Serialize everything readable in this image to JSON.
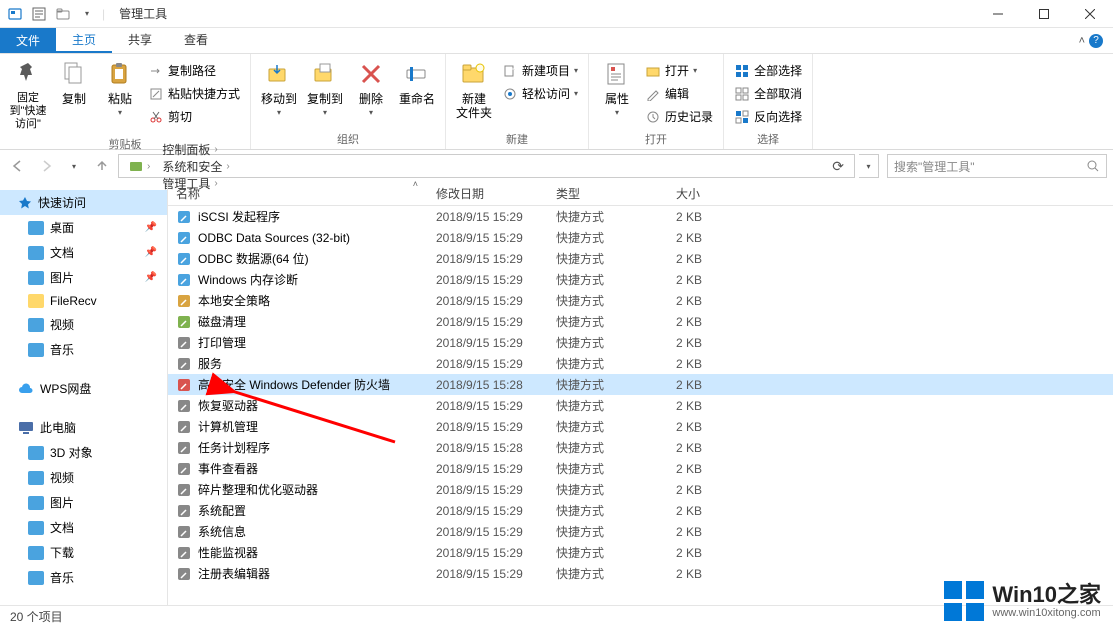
{
  "titlebar": {
    "title": "管理工具"
  },
  "tabs": {
    "file": "文件",
    "home": "主页",
    "share": "共享",
    "view": "查看"
  },
  "ribbon": {
    "pin": {
      "label": "固定到\"快速访问\""
    },
    "copy": "复制",
    "paste": "粘贴",
    "copy_path": "复制路径",
    "paste_shortcut": "粘贴快捷方式",
    "cut": "剪切",
    "group_clipboard": "剪贴板",
    "moveto": "移动到",
    "copyto": "复制到",
    "delete": "删除",
    "rename": "重命名",
    "group_organize": "组织",
    "new_folder": "新建\n文件夹",
    "new_item": "新建项目",
    "easy_access": "轻松访问",
    "group_new": "新建",
    "properties": "属性",
    "open": "打开",
    "edit": "编辑",
    "history": "历史记录",
    "group_open": "打开",
    "select_all": "全部选择",
    "select_none": "全部取消",
    "invert": "反向选择",
    "group_select": "选择"
  },
  "breadcrumbs": [
    "控制面板",
    "系统和安全",
    "管理工具"
  ],
  "search_placeholder": "搜索\"管理工具\"",
  "columns": {
    "name": "名称",
    "date": "修改日期",
    "type": "类型",
    "size": "大小"
  },
  "sidebar": {
    "quickaccess": "快速访问",
    "items1": [
      {
        "label": "桌面",
        "pin": true
      },
      {
        "label": "文档",
        "pin": true
      },
      {
        "label": "图片",
        "pin": true
      },
      {
        "label": "FileRecv",
        "pin": false
      },
      {
        "label": "视频",
        "pin": false
      },
      {
        "label": "音乐",
        "pin": false
      }
    ],
    "wps": "WPS网盘",
    "thispc": "此电脑",
    "items2": [
      {
        "label": "3D 对象"
      },
      {
        "label": "视频"
      },
      {
        "label": "图片"
      },
      {
        "label": "文档"
      },
      {
        "label": "下载"
      },
      {
        "label": "音乐"
      }
    ]
  },
  "files": [
    {
      "name": "iSCSI 发起程序",
      "date": "2018/9/15 15:29",
      "type": "快捷方式",
      "size": "2 KB",
      "sel": false
    },
    {
      "name": "ODBC Data Sources (32-bit)",
      "date": "2018/9/15 15:29",
      "type": "快捷方式",
      "size": "2 KB",
      "sel": false
    },
    {
      "name": "ODBC 数据源(64 位)",
      "date": "2018/9/15 15:29",
      "type": "快捷方式",
      "size": "2 KB",
      "sel": false
    },
    {
      "name": "Windows 内存诊断",
      "date": "2018/9/15 15:29",
      "type": "快捷方式",
      "size": "2 KB",
      "sel": false
    },
    {
      "name": "本地安全策略",
      "date": "2018/9/15 15:29",
      "type": "快捷方式",
      "size": "2 KB",
      "sel": false
    },
    {
      "name": "磁盘清理",
      "date": "2018/9/15 15:29",
      "type": "快捷方式",
      "size": "2 KB",
      "sel": false
    },
    {
      "name": "打印管理",
      "date": "2018/9/15 15:29",
      "type": "快捷方式",
      "size": "2 KB",
      "sel": false
    },
    {
      "name": "服务",
      "date": "2018/9/15 15:29",
      "type": "快捷方式",
      "size": "2 KB",
      "sel": false
    },
    {
      "name": "高级安全 Windows Defender 防火墙",
      "date": "2018/9/15 15:28",
      "type": "快捷方式",
      "size": "2 KB",
      "sel": true
    },
    {
      "name": "恢复驱动器",
      "date": "2018/9/15 15:29",
      "type": "快捷方式",
      "size": "2 KB",
      "sel": false
    },
    {
      "name": "计算机管理",
      "date": "2018/9/15 15:29",
      "type": "快捷方式",
      "size": "2 KB",
      "sel": false
    },
    {
      "name": "任务计划程序",
      "date": "2018/9/15 15:28",
      "type": "快捷方式",
      "size": "2 KB",
      "sel": false
    },
    {
      "name": "事件查看器",
      "date": "2018/9/15 15:29",
      "type": "快捷方式",
      "size": "2 KB",
      "sel": false
    },
    {
      "name": "碎片整理和优化驱动器",
      "date": "2018/9/15 15:29",
      "type": "快捷方式",
      "size": "2 KB",
      "sel": false
    },
    {
      "name": "系统配置",
      "date": "2018/9/15 15:29",
      "type": "快捷方式",
      "size": "2 KB",
      "sel": false
    },
    {
      "name": "系统信息",
      "date": "2018/9/15 15:29",
      "type": "快捷方式",
      "size": "2 KB",
      "sel": false
    },
    {
      "name": "性能监视器",
      "date": "2018/9/15 15:29",
      "type": "快捷方式",
      "size": "2 KB",
      "sel": false
    },
    {
      "name": "注册表编辑器",
      "date": "2018/9/15 15:29",
      "type": "快捷方式",
      "size": "2 KB",
      "sel": false
    }
  ],
  "status": "20 个项目",
  "watermark": {
    "title": "Win10之家",
    "url": "www.win10xitong.com"
  }
}
